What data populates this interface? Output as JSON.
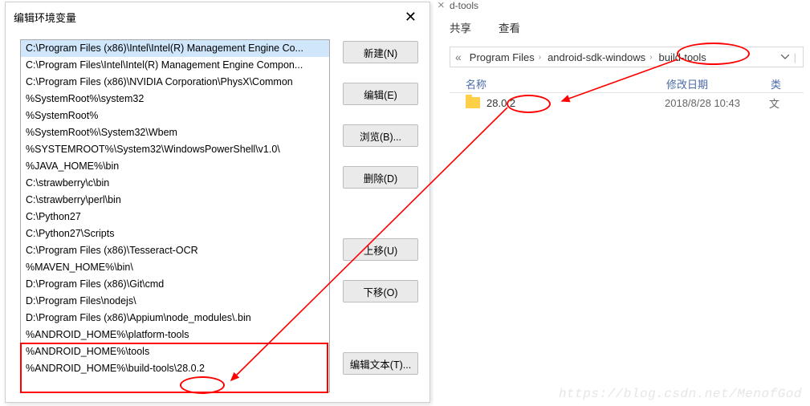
{
  "dialog": {
    "title": "编辑环境变量",
    "paths": [
      "C:\\Program Files (x86)\\Intel\\Intel(R) Management Engine Co...",
      "C:\\Program Files\\Intel\\Intel(R) Management Engine Compon...",
      "C:\\Program Files (x86)\\NVIDIA Corporation\\PhysX\\Common",
      "%SystemRoot%\\system32",
      "%SystemRoot%",
      "%SystemRoot%\\System32\\Wbem",
      "%SYSTEMROOT%\\System32\\WindowsPowerShell\\v1.0\\",
      "%JAVA_HOME%\\bin",
      "C:\\strawberry\\c\\bin",
      "C:\\strawberry\\perl\\bin",
      "C:\\Python27",
      "C:\\Python27\\Scripts",
      "C:\\Program Files (x86)\\Tesseract-OCR",
      "%MAVEN_HOME%\\bin\\",
      "D:\\Program Files (x86)\\Git\\cmd",
      "D:\\Program Files\\nodejs\\",
      "D:\\Program Files (x86)\\Appium\\node_modules\\.bin",
      "%ANDROID_HOME%\\platform-tools",
      "%ANDROID_HOME%\\tools",
      "%ANDROID_HOME%\\build-tools\\28.0.2"
    ],
    "selected_index": 0,
    "buttons": {
      "new": "新建(N)",
      "edit": "编辑(E)",
      "browse": "浏览(B)...",
      "delete": "删除(D)",
      "move_up": "上移(U)",
      "move_down": "下移(O)",
      "edit_text": "编辑文本(T)..."
    }
  },
  "explorer": {
    "tab_fragment": "d-tools",
    "commands": {
      "share": "共享",
      "view": "查看"
    },
    "breadcrumb": [
      "Program Files",
      "android-sdk-windows",
      "build-tools"
    ],
    "columns": {
      "name": "名称",
      "date": "修改日期",
      "type": "类"
    },
    "items": [
      {
        "name": "28.0.2",
        "date": "2018/8/28 10:43",
        "type": "文"
      }
    ]
  },
  "watermark": "https://blog.csdn.net/MenofGod"
}
